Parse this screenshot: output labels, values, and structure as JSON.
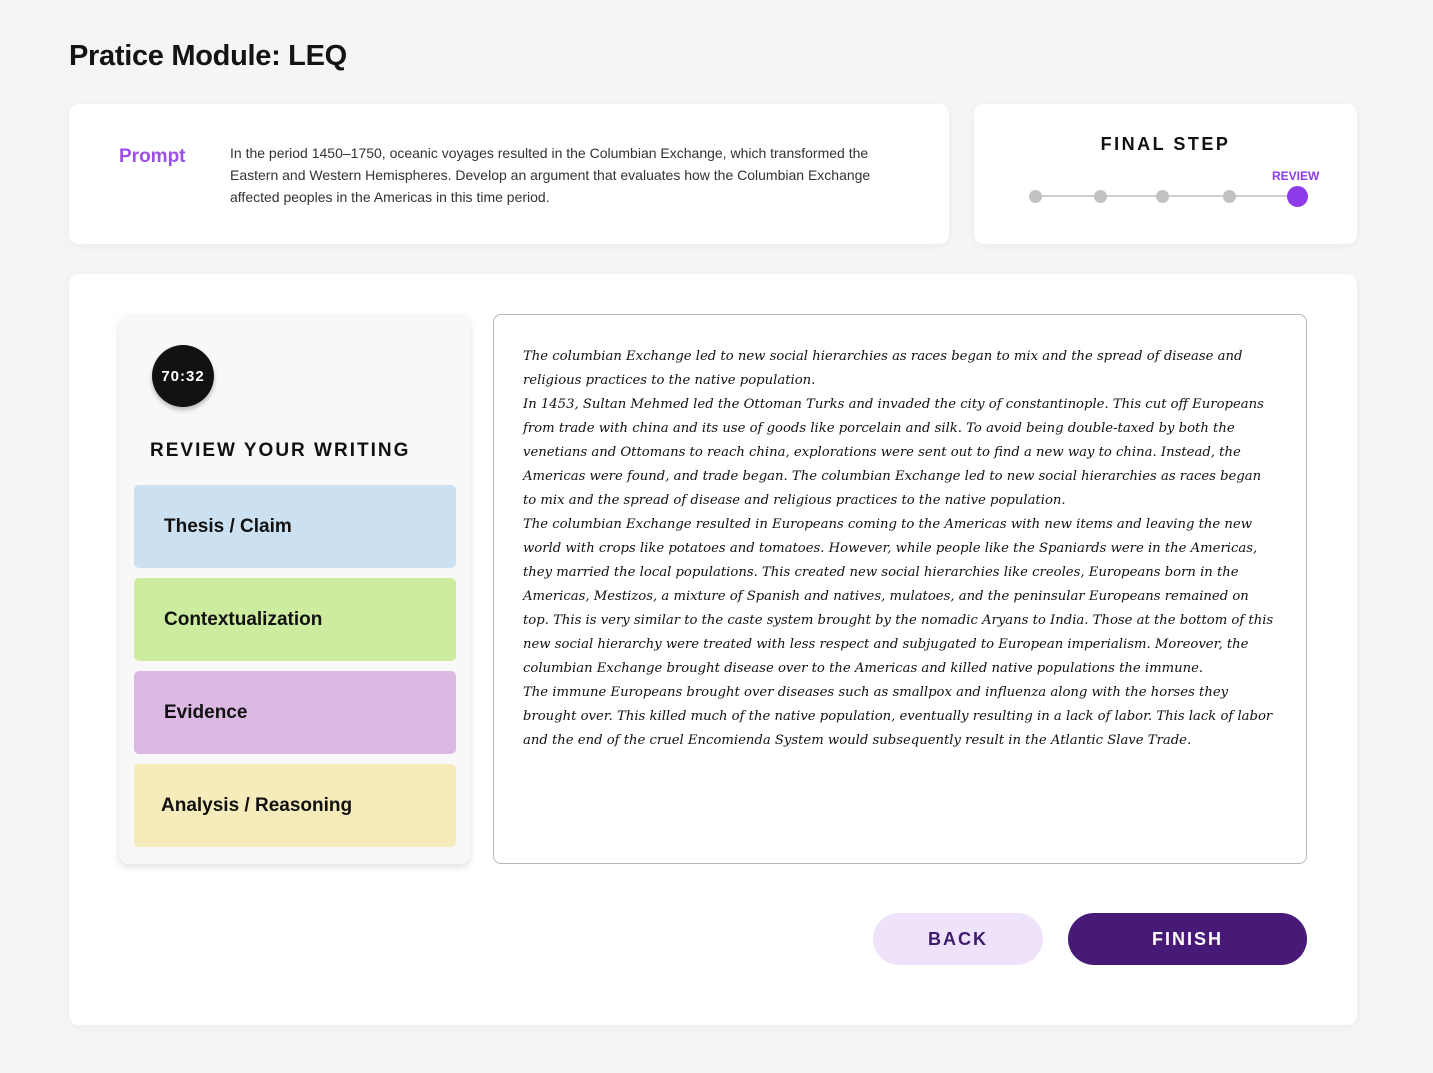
{
  "page": {
    "title": "Pratice Module: LEQ"
  },
  "prompt": {
    "label": "Prompt",
    "text": "In the period 1450–1750, oceanic voyages resulted in the Columbian Exchange, which transformed the Eastern and Western Hemispheres. Develop an argument that evaluates how the Columbian Exchange affected peoples in the Americas in this time period."
  },
  "progress": {
    "title": "FINAL STEP",
    "current_label": "REVIEW",
    "total_steps": 5,
    "current_step": 5,
    "active_color": "#8d3be8",
    "inactive_color": "#c1c1c1"
  },
  "sidebar": {
    "timer": "70:32",
    "heading": "REVIEW YOUR WRITING",
    "items": [
      {
        "label": "Thesis / Claim",
        "color": "#cbe1f1"
      },
      {
        "label": "Contextualization",
        "color": "#cdeca0"
      },
      {
        "label": "Evidence",
        "color": "#dcb9e2"
      },
      {
        "label": "Analysis / Reasoning",
        "color": "#f6ecbb"
      }
    ]
  },
  "essay": {
    "paragraphs": [
      "The columbian Exchange led to new social hierarchies as races began to mix and the spread of disease and religious practices to the native population.",
      "In 1453, Sultan Mehmed led the Ottoman Turks and invaded the city of constantinople. This cut off Europeans from trade with china and its use of goods like porcelain and silk. To avoid being double-taxed by both the venetians and Ottomans to reach china, explorations were sent out to find a new way to china. Instead, the Americas were found, and trade began. The columbian Exchange led to new social hierarchies as races began to mix and the spread of disease and religious practices to the native population.",
      "The columbian Exchange resulted in Europeans coming to the Americas with new items and leaving the new world with crops like potatoes and tomatoes. However, while people like the Spaniards were in the Americas, they married the local populations. This created new social hierarchies like creoles, Europeans born in the Americas, Mestizos, a mixture of Spanish and natives, mulatoes, and the peninsular Europeans remained on top. This is very similar to the caste system brought by the nomadic Aryans to India. Those at the bottom of this new social hierarchy were treated with less respect and subjugated to European imperialism. Moreover, the columbian Exchange brought disease over to the Americas and killed native populations the immune.",
      "The immune Europeans brought over diseases such as smallpox and influenza along with the horses they brought over. This killed much of the native population, eventually resulting in a lack of labor. This lack of labor and the end of the cruel Encomienda System would subsequently result in the Atlantic Slave Trade."
    ]
  },
  "actions": {
    "back_label": "BACK",
    "finish_label": "FINISH"
  }
}
